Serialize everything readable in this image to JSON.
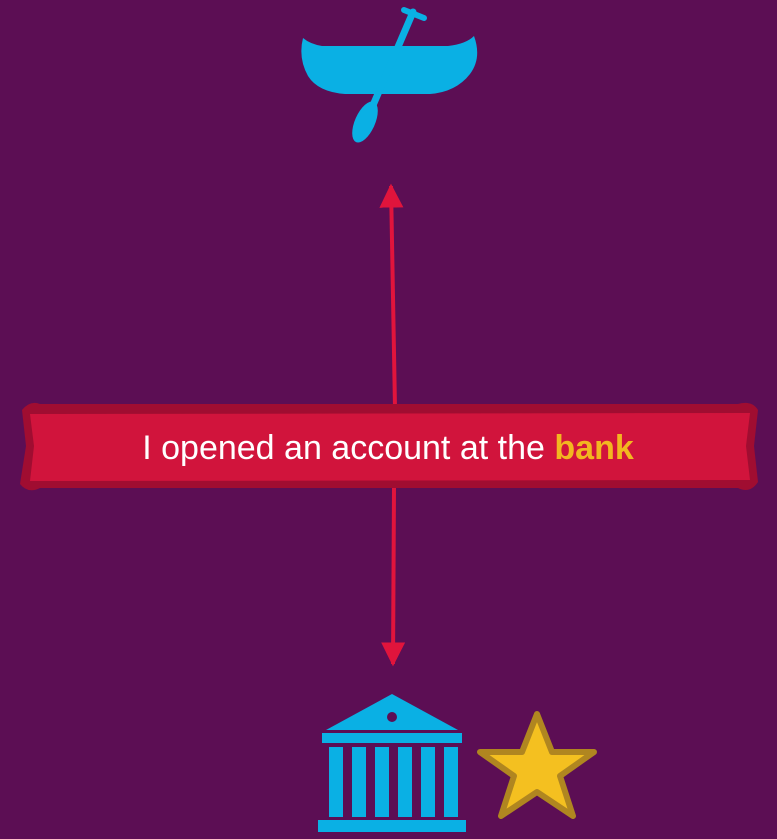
{
  "sentence": {
    "text": "I opened an account at the",
    "keyword": "bank"
  },
  "icons": {
    "top": "canoe-with-paddle-icon",
    "bottom": "bank-building-icon",
    "marker": "star-icon"
  },
  "colors": {
    "background": "#5c0e54",
    "banner": "#d1143c",
    "banner_border": "#a00d31",
    "arrow": "#e0143c",
    "icon": "#0ab0e4",
    "keyword": "#f2b720",
    "star_fill": "#f4c020",
    "star_stroke": "#b08620",
    "text": "#ffffff"
  }
}
